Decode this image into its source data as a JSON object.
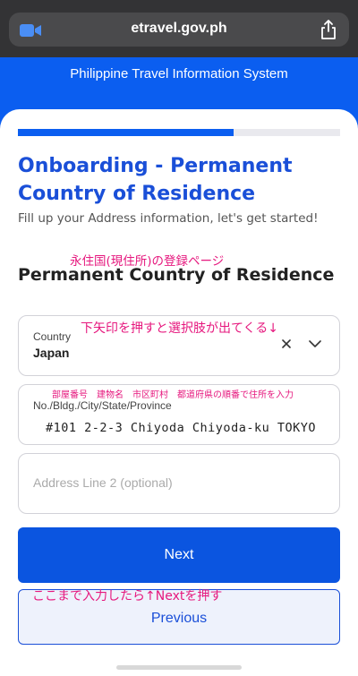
{
  "browser": {
    "url": "etravel.gov.ph",
    "icons": [
      "camera-icon",
      "share-icon"
    ]
  },
  "header": {
    "title": "Philippine Travel Information System"
  },
  "progress": {
    "percent": 67
  },
  "page": {
    "title": "Onboarding - Permanent Country of Residence",
    "subtitle": "Fill up your Address information, let's get started!",
    "section_title": "Permanent Country of Residence"
  },
  "annotations": {
    "page_note": "永住国(現住所)の登録ページ",
    "country_note": "下矢印を押すと選択肢が出てくる↓",
    "address_note": "部屋番号　建物名　市区町村　都道府県の順番で住所を入力",
    "next_note": "ここまで入力したら↑Nextを押す"
  },
  "form": {
    "country": {
      "label": "Country",
      "value": "Japan"
    },
    "address1": {
      "label": "No./Bldg./City/State/Province",
      "value": "#101 2-2-3 Chiyoda Chiyoda-ku TOKYO"
    },
    "address2": {
      "placeholder": "Address Line 2 (optional)"
    }
  },
  "buttons": {
    "next": "Next",
    "previous": "Previous"
  },
  "colors": {
    "brand": "#0b5ef0",
    "annotation": "#e6187e",
    "title": "#1a4fd8"
  }
}
